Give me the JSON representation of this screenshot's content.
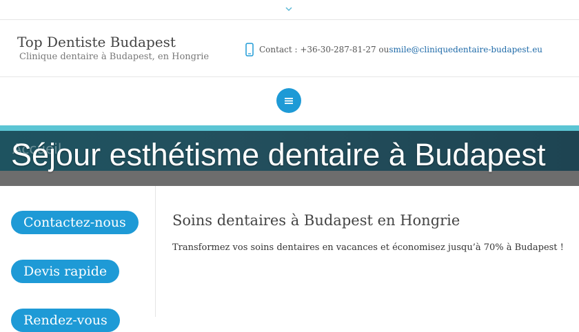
{
  "topbar": {
    "toggle_icon": "chevron-down-icon"
  },
  "header": {
    "site_title": "Top Dentiste Budapest",
    "tagline": "Clinique dentaire à Budapest, en Hongrie",
    "contact_icon": "phone-icon",
    "contact_text": "Contact : +36-30-287-81-27 ou ",
    "contact_email": "smile@cliniquedentaire-budapest.eu"
  },
  "nav": {
    "menu_icon": "hamburger-menu-icon"
  },
  "banner": {
    "breadcrumb": "Accueil",
    "title": "Séjour esthétisme dentaire à Budapest"
  },
  "sidebar": {
    "buttons": [
      "Contactez-nous",
      "Devis rapide",
      "Rendez-vous"
    ]
  },
  "main": {
    "heading": "Soins dentaires à Budapest en Hongrie",
    "intro": "Transformez vos soins dentaires en vacances et économisez jusqu’à 70% à Budapest !"
  },
  "colors": {
    "accent": "#1e9ad6",
    "banner_teal": "#5bc5d4",
    "banner_dark": "#234f5d",
    "banner_gray": "#6d6d6d",
    "link": "#1e6aa8"
  }
}
